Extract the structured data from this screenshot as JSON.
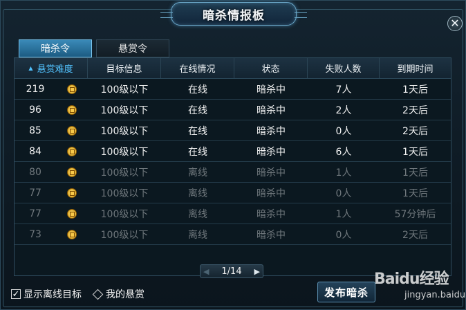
{
  "window": {
    "title": "暗杀情报板"
  },
  "tabs": [
    {
      "label": "暗杀令",
      "active": true
    },
    {
      "label": "悬赏令",
      "active": false
    }
  ],
  "table": {
    "columns": [
      "悬赏难度",
      "目标信息",
      "在线情况",
      "状态",
      "失败人数",
      "到期时间"
    ],
    "sorted_column": "悬赏难度",
    "rows": [
      {
        "difficulty": "219",
        "target": "100级以下",
        "online": "在线",
        "status": "暗杀中",
        "fails": "7人",
        "expire": "1天后",
        "is_online": true
      },
      {
        "difficulty": "96",
        "target": "100级以下",
        "online": "在线",
        "status": "暗杀中",
        "fails": "2人",
        "expire": "2天后",
        "is_online": true
      },
      {
        "difficulty": "85",
        "target": "100级以下",
        "online": "在线",
        "status": "暗杀中",
        "fails": "0人",
        "expire": "2天后",
        "is_online": true
      },
      {
        "difficulty": "84",
        "target": "100级以下",
        "online": "在线",
        "status": "暗杀中",
        "fails": "6人",
        "expire": "1天后",
        "is_online": true
      },
      {
        "difficulty": "80",
        "target": "100级以下",
        "online": "离线",
        "status": "暗杀中",
        "fails": "1人",
        "expire": "1天后",
        "is_online": false
      },
      {
        "difficulty": "77",
        "target": "100级以下",
        "online": "离线",
        "status": "暗杀中",
        "fails": "0人",
        "expire": "1天后",
        "is_online": false
      },
      {
        "difficulty": "77",
        "target": "100级以下",
        "online": "离线",
        "status": "暗杀中",
        "fails": "1人",
        "expire": "57分钟后",
        "is_online": false
      },
      {
        "difficulty": "73",
        "target": "100级以下",
        "online": "离线",
        "status": "暗杀中",
        "fails": "0人",
        "expire": "2天后",
        "is_online": false
      }
    ]
  },
  "pager": {
    "text": "1/14"
  },
  "footer": {
    "show_offline_label": "显示离线目标",
    "show_offline_checked": true,
    "my_bounty_label": "我的悬赏",
    "publish_label": "发布暗杀"
  },
  "watermark": {
    "main": "Baidu经验",
    "sub": "jingyan.baidu.com"
  },
  "icons": {
    "coin": "gold-coin-icon",
    "close": "close-icon",
    "sort": "sort-up-icon"
  },
  "colors": {
    "accent": "#52c3ff",
    "offline_text": "#6f777c",
    "active_tab": "#2c78a8"
  }
}
